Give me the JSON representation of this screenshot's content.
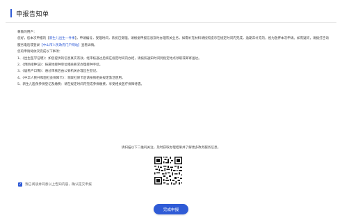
{
  "header": {
    "title": "申报告知单"
  },
  "notice": {
    "greeting": "尊敬的用户：",
    "intro": {
      "p1": "您好，您本次申报的【",
      "service_name": "新生儿出生一件事",
      "p2": "】，申请编号",
      "p3": "，受理时间",
      "p4": "，系统已受理。请根据申报信息及时办理有关业务，如需补充材料请按照提示在规定时间内完成，逾期未补充的，视为放弃本次申请。如有疑问，请拨打咨询服务电话或登录",
      "platform_link": "【中山市人民政府门户网站】",
      "p5": "查看详情。"
    },
    "section_title": "您的申请将依次完成以下事项：",
    "items": [
      "1、《出生医学证明》：如您提供的信息真实有效，经审核通过后将在规定时间内办结，请按照通知时间到指定地点领取或邮寄送达。",
      "2、《预防接种证》：按属地接种单位相关要求办理接种手续。",
      "3、《居民户口簿》：通过审核后由公安机关办理出生登记。",
      "4、《中华人民共和国社会保障卡》：领取社保卡后请按照相关规定激活使用。",
      "5、新生儿医保参保登记及缴费：请在规定时间内完成参保缴费，享受相关医疗保障待遇。"
    ],
    "qr_prompt": "请扫描以下二维码关注，及时获取办理结果并了解更多政务服务信息。"
  },
  "consent": {
    "label": "我已阅读并同意以上告知内容，确认提交申报"
  },
  "actions": {
    "submit_label": "完成申报"
  },
  "colors": {
    "accent": "#2f5bd6"
  }
}
